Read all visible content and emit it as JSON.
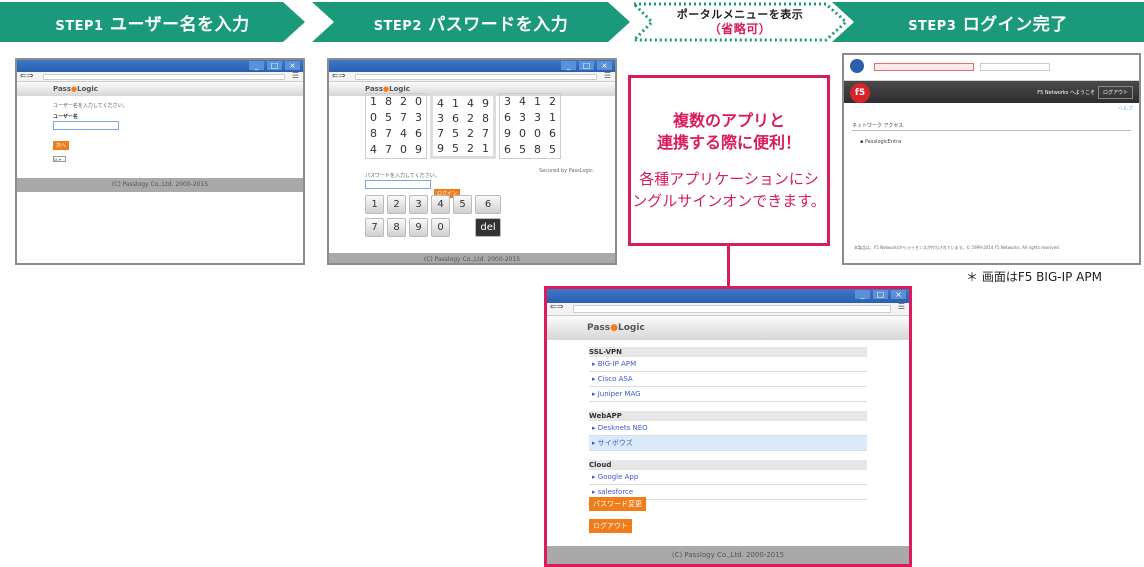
{
  "steps": [
    {
      "num": "STEP1",
      "label": "ユーザー名を入力"
    },
    {
      "num": "STEP2",
      "label": "パスワードを入力"
    },
    {
      "label": "ポータルメニューを表示",
      "sub": "（省略可）"
    },
    {
      "num": "STEP3",
      "label": "ログイン完了"
    }
  ],
  "brand": {
    "pass": "Pass",
    "logic": "Logic"
  },
  "copyright": "(C) Passlogy Co.,Ltd. 2000-2015",
  "step1_window": {
    "prompt": "ユーザー名を入力してください。",
    "username_label": "ユーザー名",
    "next_button": "次へ",
    "lang": "ja"
  },
  "step2_window": {
    "matrix": [
      [
        "1",
        "8",
        "2",
        "0",
        "4",
        "1",
        "4",
        "9",
        "3",
        "4",
        "1",
        "2"
      ],
      [
        "0",
        "5",
        "7",
        "3",
        "3",
        "6",
        "2",
        "8",
        "6",
        "3",
        "3",
        "1"
      ],
      [
        "8",
        "7",
        "4",
        "6",
        "7",
        "5",
        "2",
        "7",
        "9",
        "0",
        "0",
        "6"
      ],
      [
        "4",
        "7",
        "0",
        "9",
        "9",
        "5",
        "2",
        "1",
        "6",
        "5",
        "8",
        "5"
      ]
    ],
    "secured_by": "Secured by PassLogic.",
    "prompt": "パスワードを入力してください。",
    "login_button": "ログイン",
    "keypad": [
      "1",
      "2",
      "3",
      "4",
      "5",
      "6",
      "7",
      "8",
      "9",
      "0"
    ],
    "del_key": "del"
  },
  "step3_window": {
    "welcome": "F5 Networks へようこそ",
    "logout": "ログアウト",
    "help": "ヘルプ",
    "section": "ネットワーク アクセス",
    "item": "PasslogicEntra",
    "footer": "本製品は、F5 Networksからライセンスが付与されています。© 1999-2014 F5 Networks. All rights reserved."
  },
  "callout": {
    "headline": "複数のアプリと\n連携する際に便利！",
    "body": "各種アプリケーションにシ\nングルサインオンできます。"
  },
  "note": "＊ 画面はF5 BIG-IP APM",
  "portal": {
    "groups": [
      {
        "name": "SSL-VPN",
        "items": [
          "BIG-IP APM",
          "Cisco ASA",
          "Juniper MAG"
        ]
      },
      {
        "name": "WebAPP",
        "items": [
          "Desknets NEO",
          "サイボウズ"
        ]
      },
      {
        "name": "Cloud",
        "items": [
          "Google App",
          "salesforce"
        ]
      }
    ],
    "change_password_button": "パスワード変更",
    "logout_button": "ログアウト"
  },
  "colors": {
    "step_banner": "#1a9a7a",
    "accent": "#d81c5c",
    "button": "#f07d1a",
    "titlebar": "#2a5fae"
  }
}
